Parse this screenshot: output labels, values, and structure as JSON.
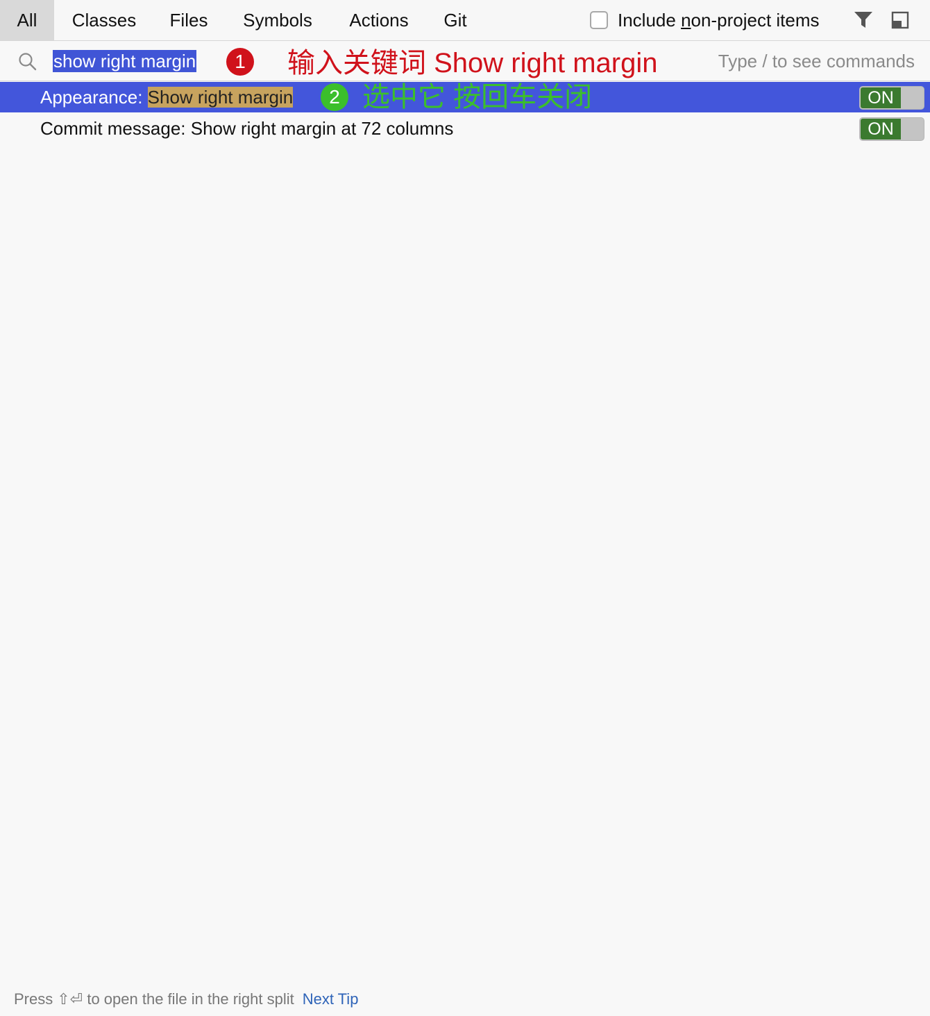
{
  "tabs": [
    {
      "label": "All",
      "active": true
    },
    {
      "label": "Classes"
    },
    {
      "label": "Files"
    },
    {
      "label": "Symbols"
    },
    {
      "label": "Actions"
    },
    {
      "label": "Git"
    }
  ],
  "toolbar": {
    "include_label_pre": "Include ",
    "include_label_u": "n",
    "include_label_post": "on-project items",
    "filter_icon": "filter-icon",
    "dock_icon": "dock-icon"
  },
  "search": {
    "value": "show right margin",
    "hint": "Type / to see commands",
    "icon": "search-icon"
  },
  "annotations": {
    "step1_number": "1",
    "step1_text": "输入关键词 Show right margin",
    "step2_number": "2",
    "step2_text": "选中它 按回车关闭"
  },
  "results": [
    {
      "prefix": "Appearance: ",
      "match": "Show right margin",
      "suffix": "",
      "toggle": "ON",
      "selected": true
    },
    {
      "prefix": "Commit message: Show right margin at 72 columns",
      "match": "",
      "suffix": "",
      "toggle": "ON",
      "selected": false
    }
  ],
  "footer": {
    "text": "Press ⇧⏎ to open the file in the right split",
    "link": "Next Tip"
  },
  "colors": {
    "selection": "#4356db",
    "match_highlight": "#c7a35e",
    "toggle_on": "#3b7a2f",
    "annotation_red": "#d0121b",
    "annotation_green": "#3bbf2b",
    "link": "#2f64b8"
  }
}
